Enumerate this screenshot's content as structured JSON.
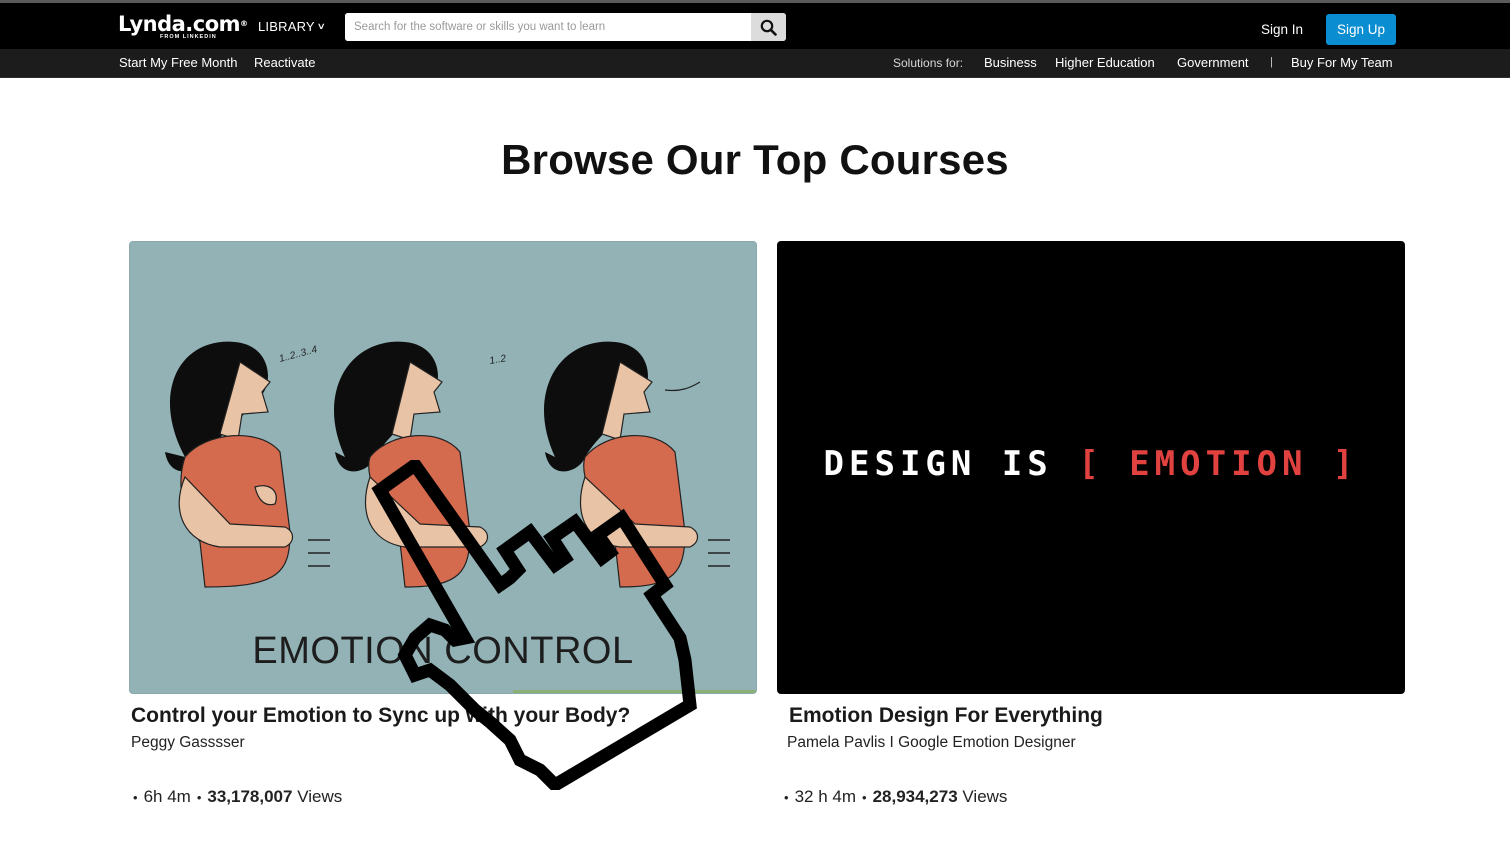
{
  "header": {
    "logo_text": "Lynda.com",
    "logo_reg": "®",
    "logo_sub": "FROM LINKEDIN",
    "library_label": "LIBRARY",
    "search_placeholder": "Search for the software or skills you want to learn",
    "sign_in": "Sign In",
    "sign_up": "Sign Up",
    "accent_color": "#0a8ed1"
  },
  "subnav": {
    "start_free": "Start My Free Month",
    "reactivate": "Reactivate",
    "solutions_label": "Solutions for:",
    "business": "Business",
    "higher_education": "Higher Education",
    "government": "Government",
    "separator": "|",
    "buy_team": "Buy For My Team"
  },
  "main": {
    "title": "Browse Our Top Courses",
    "courses": [
      {
        "thumbnail_caption": "EMOTION CONTROL",
        "breath_counts": [
          "1..2..3..4",
          "1..2"
        ],
        "title": "Control your Emotion to Sync up with your Body?",
        "author": "Peggy Gasssser",
        "duration": "6h 4m",
        "views_count": "33,178,007",
        "views_label": "Views"
      },
      {
        "thumbnail_text_white": "DESIGN IS",
        "thumbnail_text_red": "[ EMOTION ]",
        "title": "Emotion Design For Everything",
        "author": "Pamela Pavlis I Google Emotion Designer",
        "duration": "32 h 4m",
        "views_count": "28,934,273",
        "views_label": "Views"
      }
    ]
  },
  "icons": {
    "search": "search-icon",
    "chevron": "chevron-down-icon",
    "cursor": "pointer-hand-icon"
  }
}
